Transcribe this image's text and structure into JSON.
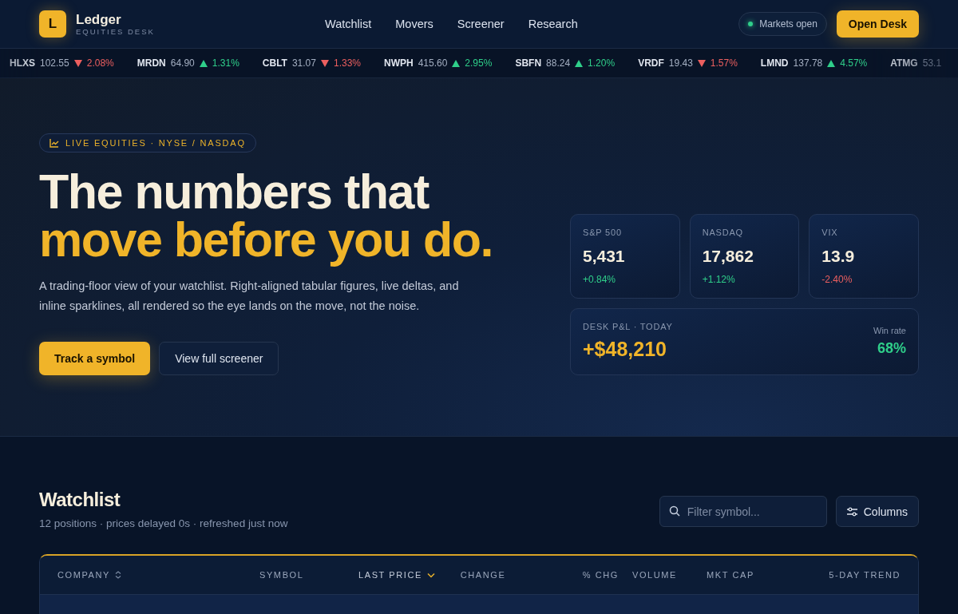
{
  "brand": {
    "mark": "L",
    "name": "Ledger",
    "subtitle": "EQUITIES DESK"
  },
  "nav": [
    {
      "label": "Watchlist"
    },
    {
      "label": "Movers"
    },
    {
      "label": "Screener"
    },
    {
      "label": "Research"
    }
  ],
  "market_status": {
    "label": "Markets open",
    "open": true
  },
  "open_desk_button": "Open Desk",
  "ticker": [
    {
      "symbol": "HLXS",
      "price": "102.55",
      "change": "2.08%",
      "rising": false
    },
    {
      "symbol": "MRDN",
      "price": "64.90",
      "change": "1.31%",
      "rising": true
    },
    {
      "symbol": "CBLT",
      "price": "31.07",
      "change": "1.33%",
      "rising": false
    },
    {
      "symbol": "NWPH",
      "price": "415.60",
      "change": "2.95%",
      "rising": true
    },
    {
      "symbol": "SBFN",
      "price": "88.24",
      "change": "1.20%",
      "rising": true
    },
    {
      "symbol": "VRDF",
      "price": "19.43",
      "change": "1.57%",
      "rising": false
    },
    {
      "symbol": "LMND",
      "price": "137.78",
      "change": "4.57%",
      "rising": true
    },
    {
      "symbol": "ATMG",
      "price": "53.1"
    }
  ],
  "hero": {
    "badge": "LIVE EQUITIES · NYSE / NASDAQ",
    "headline_line1": "The numbers that",
    "headline_line2": "move before you do.",
    "description": "A trading-floor view of your watchlist. Right-aligned tabular figures, live deltas, and inline sparklines, all rendered so the eye lands on the move, not the noise.",
    "primary_button": "Track a symbol",
    "secondary_button": "View full screener"
  },
  "indices": [
    {
      "name": "S&P 500",
      "value": "5,431",
      "change": "+0.84%",
      "rising": true
    },
    {
      "name": "NASDAQ",
      "value": "17,862",
      "change": "+1.12%",
      "rising": true
    },
    {
      "name": "VIX",
      "value": "13.9",
      "change": "-2.40%",
      "rising": false
    }
  ],
  "pnl": {
    "label": "DESK P&L · TODAY",
    "value": "+$48,210",
    "win_rate_label": "Win rate",
    "win_rate": "68%"
  },
  "watchlist": {
    "title": "Watchlist",
    "subtitle": "12 positions · prices delayed 0s · refreshed just now",
    "filter": {
      "placeholder": "Filter symbol..."
    },
    "columns_button": "Columns",
    "columns": [
      {
        "label": "COMPANY",
        "sortable": true,
        "sorted": false
      },
      {
        "label": "SYMBOL",
        "sortable": false,
        "sorted": false
      },
      {
        "label": "LAST PRICE",
        "sortable": true,
        "sorted": true
      },
      {
        "label": "CHANGE",
        "sortable": false,
        "sorted": false
      },
      {
        "label": "% CHG",
        "sortable": false,
        "sorted": false
      },
      {
        "label": "VOLUME",
        "sortable": false,
        "sorted": false
      },
      {
        "label": "MKT CAP",
        "sortable": false,
        "sorted": false
      },
      {
        "label": "5-DAY TREND",
        "sortable": false,
        "sorted": false
      }
    ]
  }
}
